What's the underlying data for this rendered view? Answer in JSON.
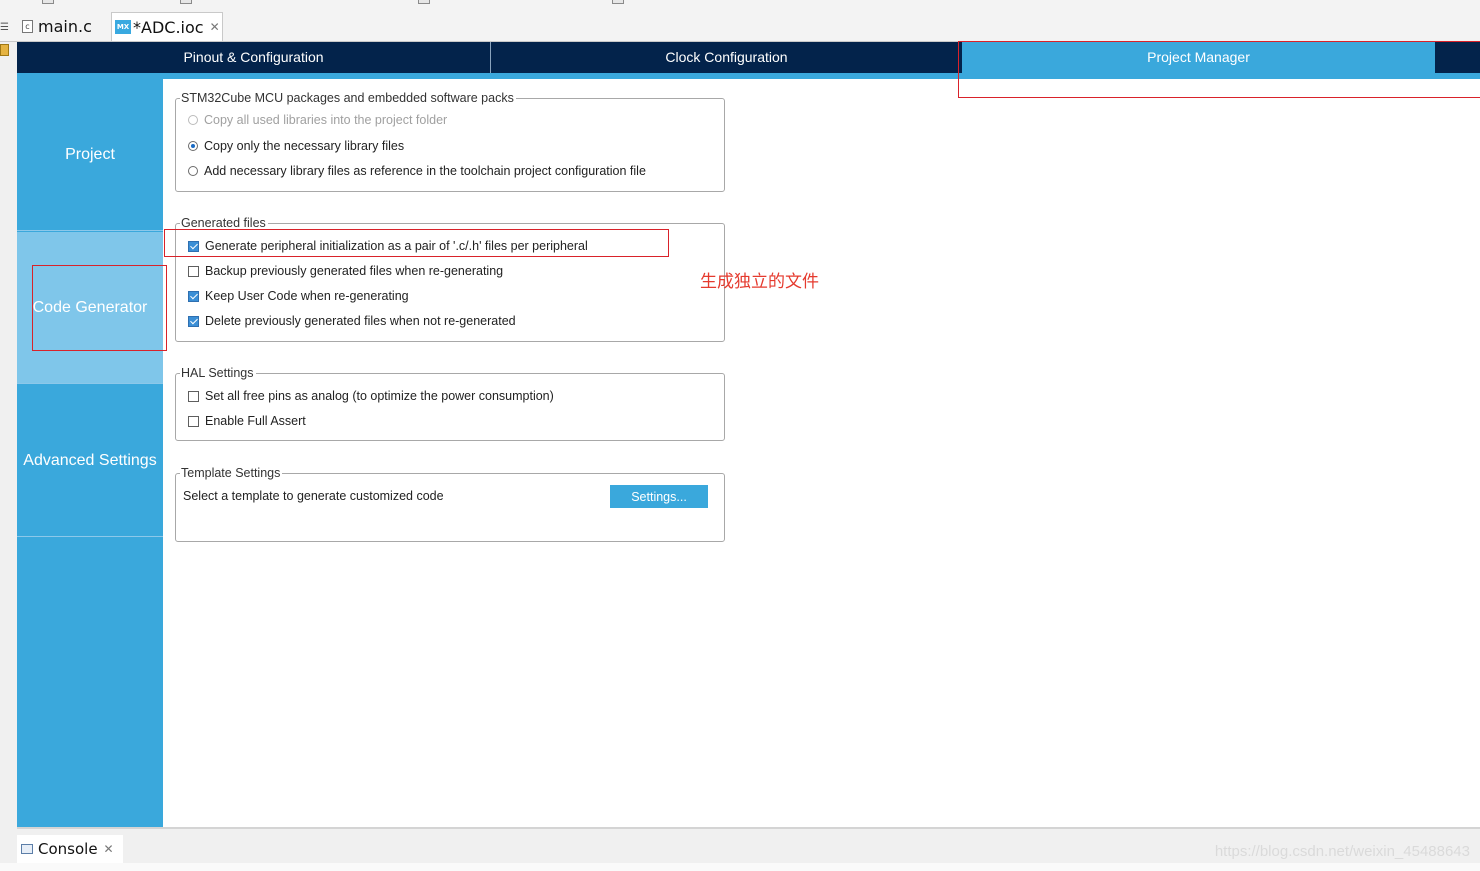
{
  "editor_tabs": [
    {
      "label": "main.c",
      "icon": "c-file-icon"
    },
    {
      "label": "*ADC.ioc",
      "icon": "mx-icon",
      "icon_text": "MX",
      "close": "✕"
    }
  ],
  "main_tabs": [
    {
      "label": "Pinout & Configuration"
    },
    {
      "label": "Clock Configuration"
    },
    {
      "label": "Project Manager",
      "active": true
    }
  ],
  "sidebar": [
    {
      "label": "Project"
    },
    {
      "label": "Code Generator",
      "active": true
    },
    {
      "label": "Advanced Settings"
    }
  ],
  "groups": {
    "packages": {
      "title": "STM32Cube MCU packages and embedded software packs",
      "options": [
        {
          "label": "Copy all used libraries into the project folder",
          "selected": false,
          "enabled": false
        },
        {
          "label": "Copy only the necessary library files",
          "selected": true,
          "enabled": true
        },
        {
          "label": "Add necessary library files as reference in the toolchain project configuration file",
          "selected": false,
          "enabled": true
        }
      ]
    },
    "generated": {
      "title": "Generated files",
      "options": [
        {
          "label": "Generate peripheral initialization as a pair of '.c/.h' files per peripheral",
          "checked": true
        },
        {
          "label": "Backup previously generated files when re-generating",
          "checked": false
        },
        {
          "label": "Keep User Code when re-generating",
          "checked": true
        },
        {
          "label": "Delete previously generated files when not re-generated",
          "checked": true
        }
      ]
    },
    "hal": {
      "title": "HAL Settings",
      "options": [
        {
          "label": "Set all free pins as analog (to optimize the power consumption)",
          "checked": false
        },
        {
          "label": "Enable Full Assert",
          "checked": false
        }
      ]
    },
    "template": {
      "title": "Template Settings",
      "text": "Select a template to generate customized code",
      "button": "Settings..."
    }
  },
  "annotation": {
    "text": "生成独立的文件",
    "color": "#e53a2e"
  },
  "console": {
    "label": "Console",
    "close": "✕"
  },
  "watermark": "https://blog.csdn.net/weixin_45488643",
  "colors": {
    "accent": "#3aa8dc",
    "navbar": "#03234b",
    "sidebar_active": "#7fc6ea",
    "annotation_red": "#d9222a"
  }
}
